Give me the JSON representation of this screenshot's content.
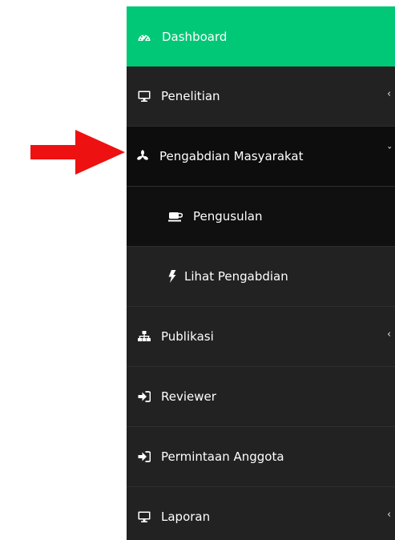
{
  "sidebar": {
    "items": [
      {
        "label": "Dashboard",
        "icon": "dashboard-icon",
        "state": "highlighted"
      },
      {
        "label": "Penelitian",
        "icon": "monitor-icon",
        "chevron": "‹"
      },
      {
        "label": "Pengabdian Masyarakat",
        "icon": "asterisk-icon",
        "chevron": "ˇ",
        "state": "expanded"
      },
      {
        "label": "Publikasi",
        "icon": "sitemap-icon",
        "chevron": "‹"
      },
      {
        "label": "Reviewer",
        "icon": "sign-in-icon"
      },
      {
        "label": "Permintaan Anggota",
        "icon": "sign-in-icon"
      },
      {
        "label": "Laporan",
        "icon": "monitor-icon",
        "chevron": "‹"
      }
    ],
    "submenu": [
      {
        "label": "Pengusulan",
        "icon": "coffee-cup-icon",
        "state": "active"
      },
      {
        "label": "Lihat Pengabdian",
        "icon": "bolt-icon"
      }
    ]
  },
  "colors": {
    "dashboard_bg": "#00c877",
    "sidebar_bg": "#222222",
    "expanded_bg": "#0d0d0d",
    "pointer_arrow": "#ee1111"
  }
}
